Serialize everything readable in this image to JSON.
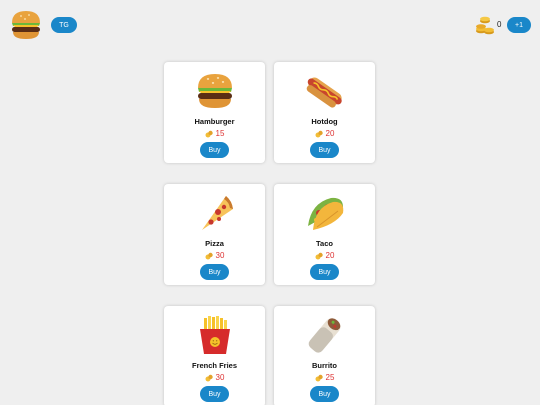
{
  "header": {
    "tg_label": "TG",
    "coins": "0",
    "add_label": "+1"
  },
  "products": [
    {
      "name": "Hamburger",
      "price": "15",
      "buy": "Buy",
      "icon": "hamburger-icon"
    },
    {
      "name": "Hotdog",
      "price": "20",
      "buy": "Buy",
      "icon": "hotdog-icon"
    },
    {
      "name": "Pizza",
      "price": "30",
      "buy": "Buy",
      "icon": "pizza-icon"
    },
    {
      "name": "Taco",
      "price": "20",
      "buy": "Buy",
      "icon": "taco-icon"
    },
    {
      "name": "French Fries",
      "price": "30",
      "buy": "Buy",
      "icon": "french-fries-icon"
    },
    {
      "name": "Burrito",
      "price": "25",
      "buy": "Buy",
      "icon": "burrito-icon"
    }
  ],
  "colors": {
    "accent": "#1a87c9",
    "price": "#dd3333",
    "background": "#efefef"
  }
}
